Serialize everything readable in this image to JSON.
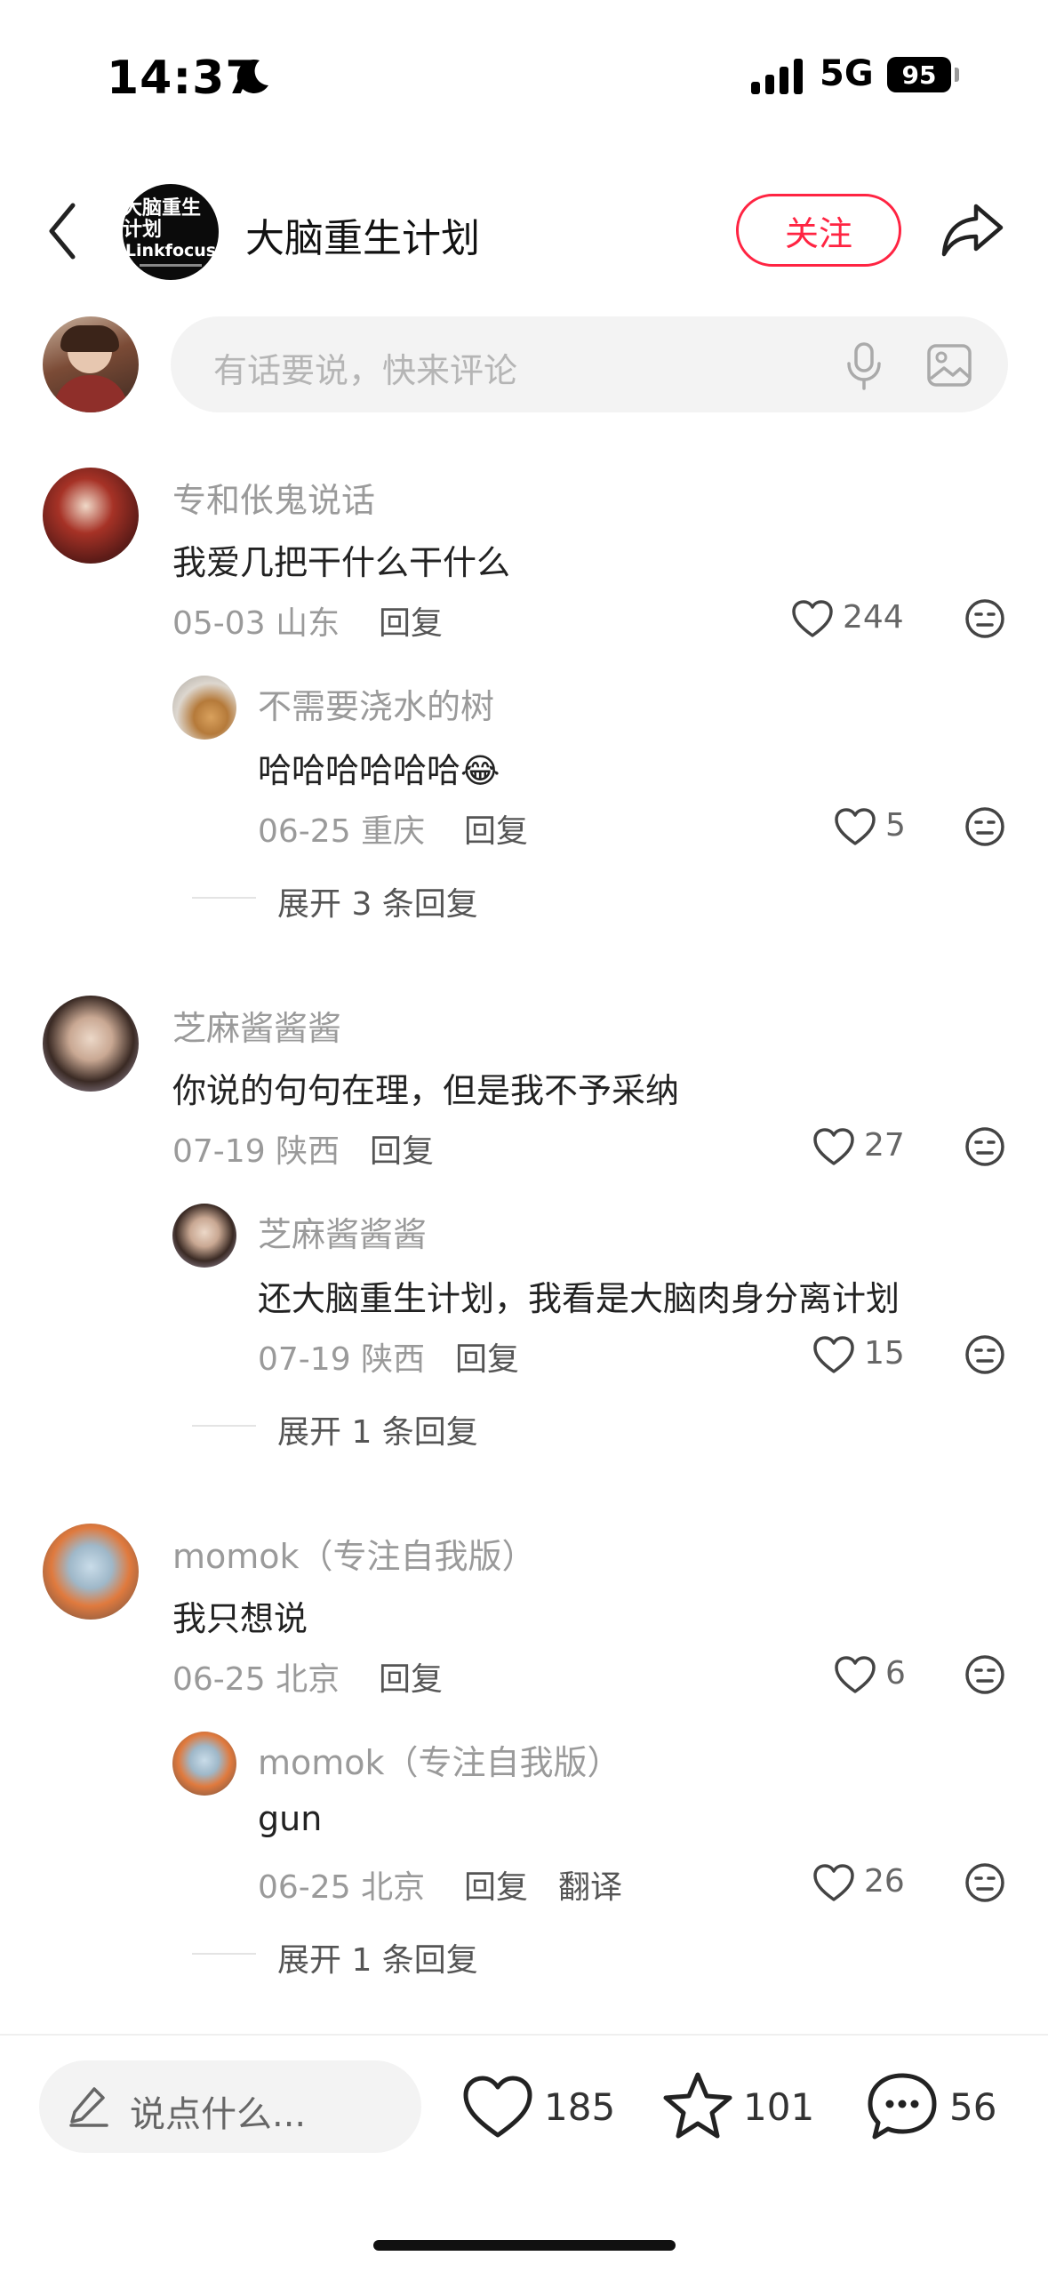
{
  "status_bar": {
    "time": "14:37",
    "network": "5G",
    "battery": "95"
  },
  "header": {
    "account_name": "大脑重生计划",
    "logo_line1": "大脑重生计划",
    "logo_line2": "Linkfocus",
    "follow_label": "关注"
  },
  "comment_input": {
    "placeholder": "有话要说，快来评论"
  },
  "comments": [
    {
      "user": "专和伥鬼说话",
      "text": "我爱几把干什么干什么",
      "date": "05-03",
      "location": "山东",
      "reply_label": "回复",
      "likes": "244",
      "reply": {
        "user": "不需要浇水的树",
        "text": "哈哈哈哈哈哈😂",
        "date": "06-25",
        "location": "重庆",
        "reply_label": "回复",
        "likes": "5"
      },
      "expand": "展开 3 条回复"
    },
    {
      "user": "芝麻酱酱酱",
      "text": "你说的句句在理，但是我不予采纳",
      "date": "07-19",
      "location": "陕西",
      "reply_label": "回复",
      "likes": "27",
      "reply": {
        "user": "芝麻酱酱酱",
        "text": "还大脑重生计划，我看是大脑肉身分离计划",
        "date": "07-19",
        "location": "陕西",
        "reply_label": "回复",
        "likes": "15"
      },
      "expand": "展开 1 条回复"
    },
    {
      "user": "momok（专注自我版）",
      "text": "我只想说",
      "date": "06-25",
      "location": "北京",
      "reply_label": "回复",
      "likes": "6",
      "reply": {
        "user": "momok（专注自我版）",
        "text": "gun",
        "date": "06-25",
        "location": "北京",
        "reply_label": "回复",
        "translate_label": "翻译",
        "likes": "26"
      },
      "expand": "展开 1 条回复"
    }
  ],
  "bottom_bar": {
    "input_placeholder": "说点什么...",
    "likes": "185",
    "collects": "101",
    "comments": "56"
  },
  "colors": {
    "accent": "#ff2442",
    "secondary_text": "#9a9a9a"
  },
  "icons": [
    "moon-icon",
    "signal-icon",
    "back-icon",
    "share-icon",
    "mic-icon",
    "image-icon",
    "heart-icon",
    "dislike-icon",
    "pen-icon",
    "star-icon",
    "comment-icon"
  ]
}
